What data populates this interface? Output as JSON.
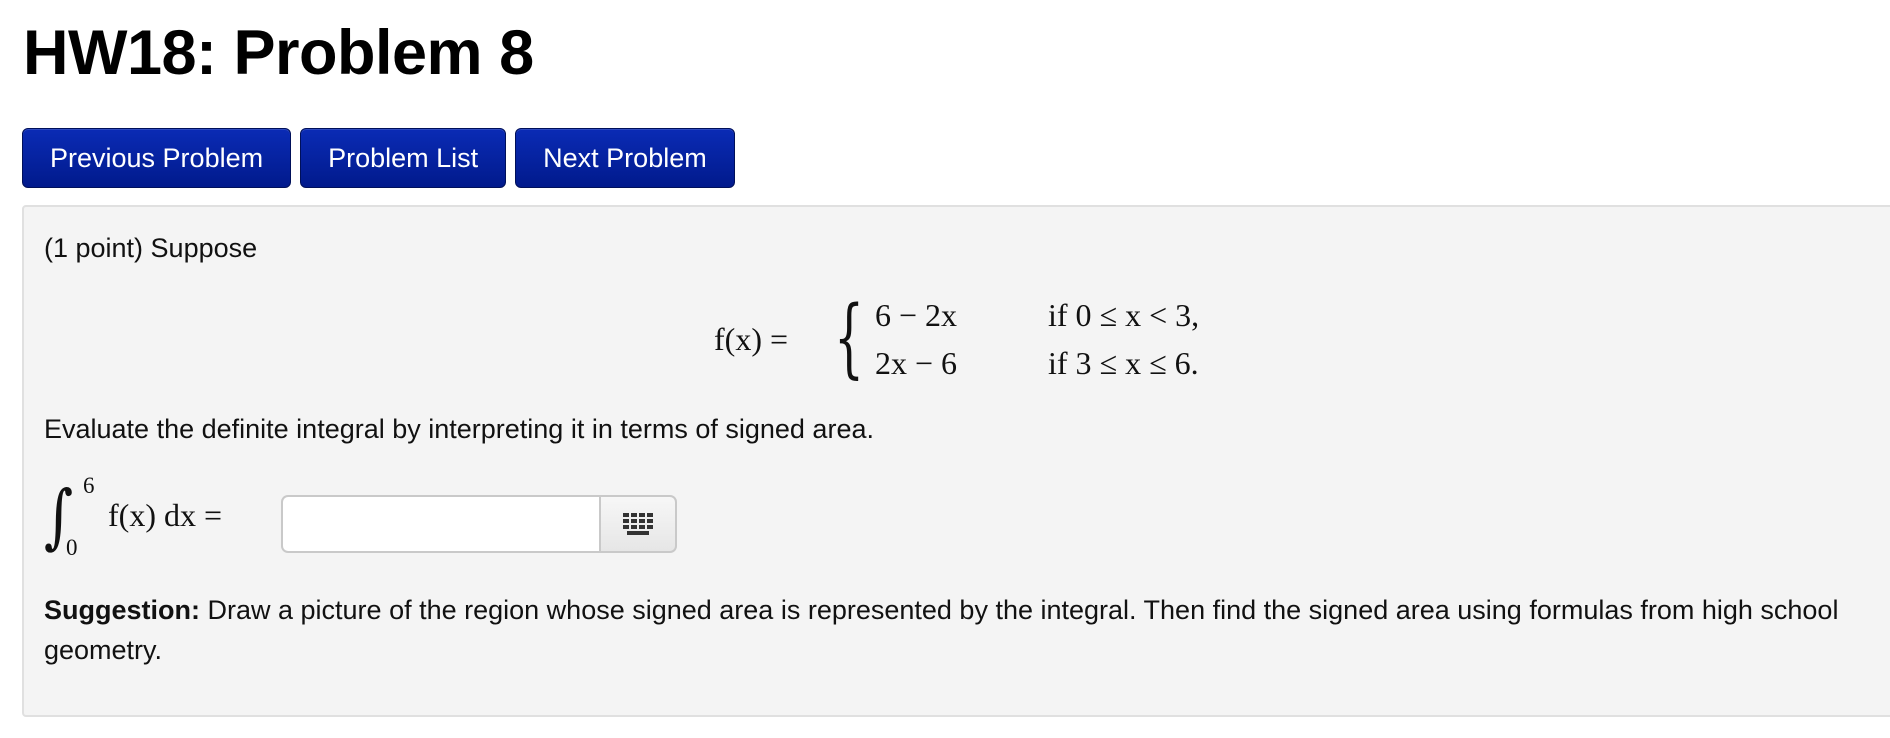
{
  "header": {
    "title": "HW18: Problem 8"
  },
  "nav": {
    "previous_label": "Previous Problem",
    "list_label": "Problem List",
    "next_label": "Next Problem",
    "button_color": "#0a2bb5"
  },
  "problem": {
    "intro": "(1 point) Suppose",
    "function_lhs": "f(x) =",
    "cases": [
      {
        "expr": "6 − 2x",
        "condition": "if 0 ≤ x < 3,"
      },
      {
        "expr": "2x − 6",
        "condition": "if 3 ≤ x ≤ 6."
      }
    ],
    "instruction": "Evaluate the definite integral by interpreting it in terms of signed area.",
    "integral": {
      "lower": "0",
      "upper": "6",
      "integrand": "f(x) dx ="
    },
    "answer": {
      "value": "",
      "placeholder": ""
    },
    "palette_icon": "grid-keyboard-icon",
    "suggestion_label": "Suggestion:",
    "suggestion_text": " Draw a picture of the region whose signed area is represented by the integral. Then find the signed area using formulas from high school geometry."
  },
  "colors": {
    "box_background": "#f4f4f4",
    "button_background": "#011a8c"
  }
}
